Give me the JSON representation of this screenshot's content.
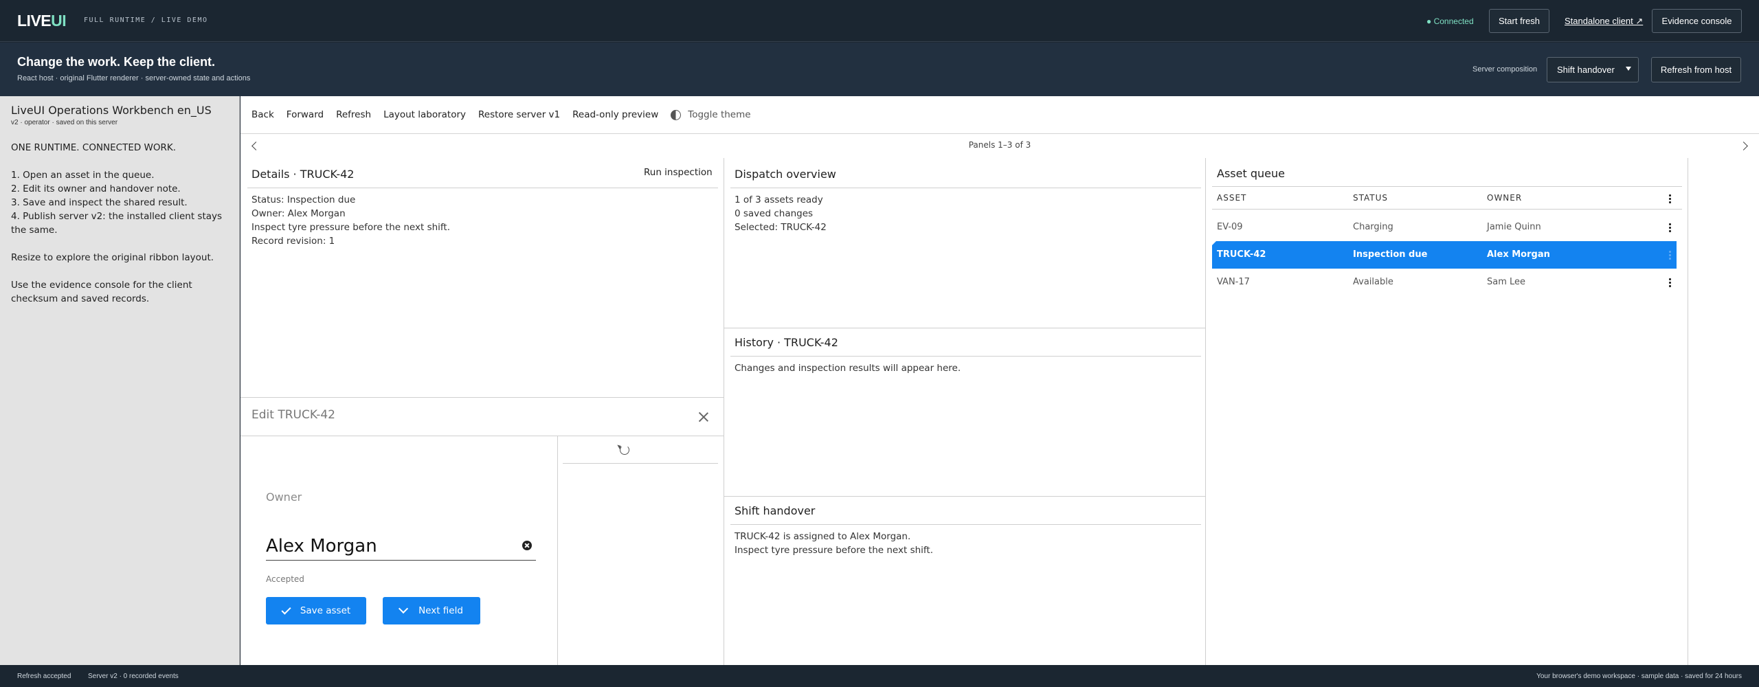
{
  "topbar": {
    "logo_main": "LIVE",
    "logo_accent": "UI",
    "runtime_label": "FULL RUNTIME / LIVE DEMO",
    "connection_status": "● Connected",
    "start_fresh": "Start fresh",
    "standalone_client": "Standalone client ↗",
    "evidence_console": "Evidence console"
  },
  "subheader": {
    "title": "Change the work. Keep the client.",
    "description": "React host · original Flutter renderer · server-owned state and actions",
    "composition_label": "Server composition",
    "composition_value": "Shift handover",
    "refresh_from_host": "Refresh from host"
  },
  "sidebar": {
    "title": "LiveUI Operations Workbench en_US",
    "subtitle": "v2 · operator · saved on this server",
    "heading": "ONE RUNTIME. CONNECTED WORK.",
    "steps": [
      "1. Open an asset in the queue.",
      "2. Edit its owner and handover note.",
      "3. Save and inspect the shared result.",
      "4. Publish server v2: the installed client stays the same."
    ],
    "note_resize": "Resize to explore the original ribbon layout.",
    "note_console": "Use the evidence console for the client checksum and saved records."
  },
  "toolbar": {
    "back": "Back",
    "forward": "Forward",
    "refresh": "Refresh",
    "layout_lab": "Layout laboratory",
    "restore": "Restore server v1",
    "readonly": "Read-only preview",
    "toggle_theme": "Toggle theme"
  },
  "pager": {
    "text": "Panels 1–3 of 3"
  },
  "details": {
    "title": "Details · TRUCK-42",
    "run_inspection": "Run inspection",
    "status": "Status: Inspection due",
    "owner": "Owner: Alex Morgan",
    "note": "Inspect tyre pressure before the next shift.",
    "revision": "Record revision: 1"
  },
  "edit": {
    "title": "Edit TRUCK-42",
    "owner_label": "Owner",
    "owner_value": "Alex Morgan",
    "helper": "Accepted",
    "save_asset": "Save asset",
    "next_field": "Next field"
  },
  "dispatch": {
    "title": "Dispatch overview",
    "ready": "1 of 3 assets ready",
    "saved": "0 saved changes",
    "selected": "Selected: TRUCK-42"
  },
  "history": {
    "title": "History · TRUCK-42",
    "empty": "Changes and inspection results will appear here."
  },
  "handover": {
    "title": "Shift handover",
    "line1": "TRUCK-42 is assigned to Alex Morgan.",
    "line2": "Inspect tyre pressure before the next shift."
  },
  "asset_queue": {
    "title": "Asset queue",
    "columns": [
      "ASSET",
      "STATUS",
      "OWNER"
    ],
    "rows": [
      {
        "asset": "EV-09",
        "status": "Charging",
        "owner": "Jamie Quinn",
        "selected": false
      },
      {
        "asset": "TRUCK-42",
        "status": "Inspection due",
        "owner": "Alex Morgan",
        "selected": true
      },
      {
        "asset": "VAN-17",
        "status": "Available",
        "owner": "Sam Lee",
        "selected": false
      }
    ]
  },
  "footer": {
    "left1": "Refresh accepted",
    "left2": "Server v2 · 0 recorded events",
    "right": "Your browser's demo workspace · sample data · saved for 24 hours"
  },
  "colors": {
    "accent": "#1383f0",
    "topbar_bg": "#1b2631",
    "connected": "#7fe0c3"
  }
}
